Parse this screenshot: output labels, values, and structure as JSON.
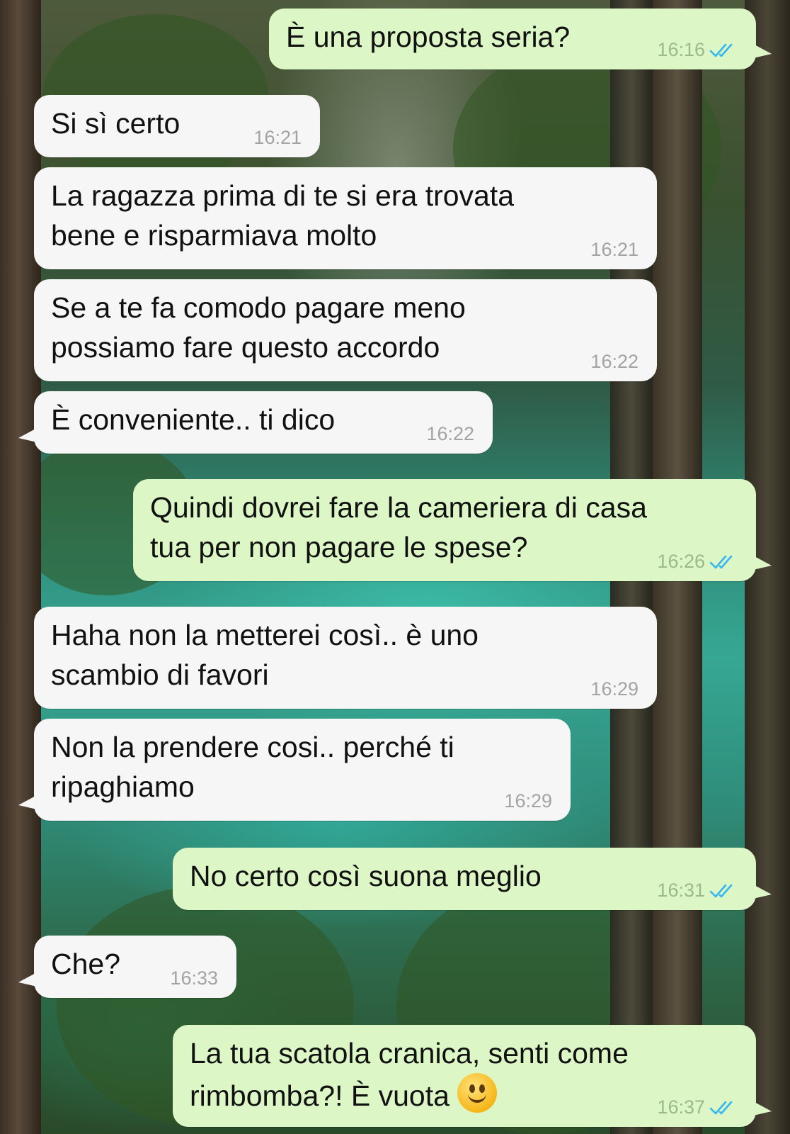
{
  "chat": {
    "messages": [
      {
        "direction": "out",
        "text": "È una proposta seria?",
        "time": "16:16",
        "status": "read"
      },
      {
        "direction": "in",
        "text": "Si sì certo",
        "time": "16:21"
      },
      {
        "direction": "in",
        "text": "La ragazza prima di te si era trovata\nbene e risparmiava molto",
        "time": "16:21"
      },
      {
        "direction": "in",
        "text": "Se a te fa comodo pagare meno\npossiamo fare questo accordo",
        "time": "16:22"
      },
      {
        "direction": "in",
        "text": "È conveniente.. ti dico",
        "time": "16:22"
      },
      {
        "direction": "out",
        "text": "Quindi dovrei fare la cameriera di casa\ntua per non pagare le spese?",
        "time": "16:26",
        "status": "read"
      },
      {
        "direction": "in",
        "text": "Haha non la metterei così.. è uno\nscambio di favori",
        "time": "16:29"
      },
      {
        "direction": "in",
        "text": "Non la prendere cosi.. perché ti\nripaghiamo",
        "time": "16:29"
      },
      {
        "direction": "out",
        "text": "No certo così suona meglio",
        "time": "16:31",
        "status": "read"
      },
      {
        "direction": "in",
        "text": "Che?",
        "time": "16:33"
      },
      {
        "direction": "out",
        "text": "La tua scatola cranica, senti come\nrimbomba?! È vuota",
        "time": "16:37",
        "status": "read",
        "emoji": "slightly-smiling-face-icon"
      }
    ]
  },
  "colors": {
    "incoming_bubble": "#f6f6f6",
    "outgoing_bubble": "#dcf7c5",
    "read_check": "#34b7f1",
    "timestamp": "#a3a3a3"
  }
}
